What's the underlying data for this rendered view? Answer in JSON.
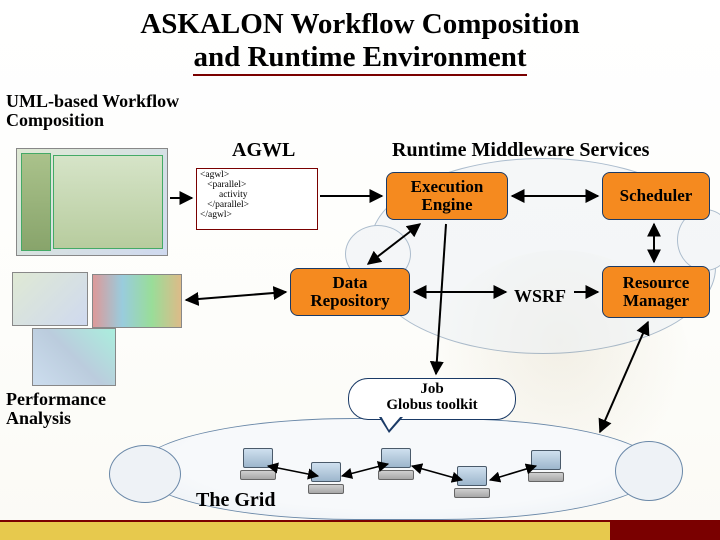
{
  "title_line1": "ASKALON Workflow Composition",
  "title_line2": "and Runtime Environment",
  "labels": {
    "uml": "UML-based Workflow Composition",
    "agwl": "AGWL",
    "runtime": "Runtime Middleware Services",
    "perf": "Performance Analysis",
    "grid": "The Grid",
    "wsrf": "WSRF"
  },
  "nodes": {
    "exec": "Execution Engine",
    "sched": "Scheduler",
    "datar": "Data Repository",
    "resm": "Resource Manager"
  },
  "agwl_code": "<agwl>\n   <parallel>\n        activity\n   </parallel>\n</agwl>",
  "job_line1": "Job",
  "job_line2": "Globus toolkit"
}
